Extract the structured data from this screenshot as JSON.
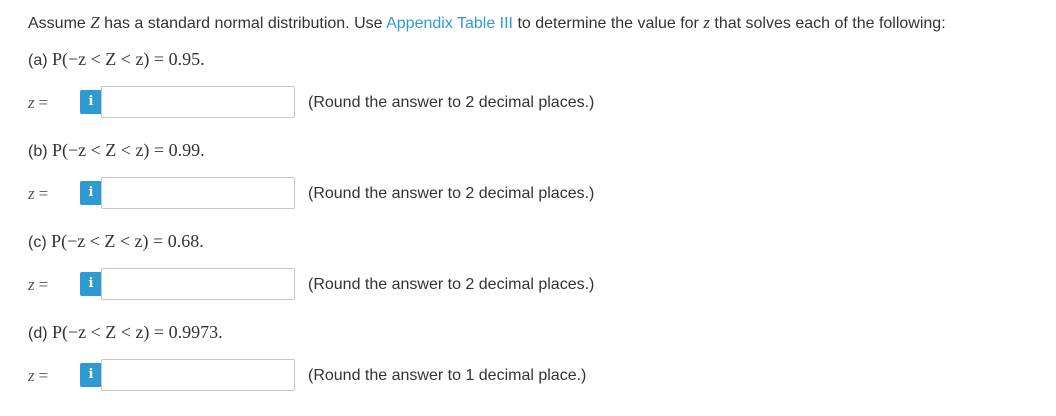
{
  "intro": {
    "before": "Assume ",
    "var_z_cap": "Z",
    "middle": " has a standard normal distribution. Use ",
    "link_text": "Appendix Table III",
    "after_link": " to determine the value for ",
    "var_z": "z",
    "end": " that solves each of the following:"
  },
  "parts": [
    {
      "label": "(a) ",
      "expression": "P(−z < Z < z) = 0.95.",
      "answer_label": "z",
      "answer_eq": "=",
      "input_value": "",
      "hint": "(Round the answer to 2 decimal places.)"
    },
    {
      "label": "(b) ",
      "expression": "P(−z < Z < z) = 0.99.",
      "answer_label": "z",
      "answer_eq": "=",
      "input_value": "",
      "hint": "(Round the answer to 2 decimal places.)"
    },
    {
      "label": "(c) ",
      "expression": "P(−z < Z < z) = 0.68.",
      "answer_label": "z",
      "answer_eq": "=",
      "input_value": "",
      "hint": "(Round the answer to 2 decimal places.)"
    },
    {
      "label": "(d) ",
      "expression": "P(−z < Z < z) = 0.9973.",
      "answer_label": "z",
      "answer_eq": "=",
      "input_value": "",
      "hint": "(Round the answer to 1 decimal place.)"
    }
  ],
  "info_icon": "info-icon",
  "colors": {
    "link": "#2f9bd6",
    "info_button": "#2d9ad1",
    "text": "#333333"
  }
}
